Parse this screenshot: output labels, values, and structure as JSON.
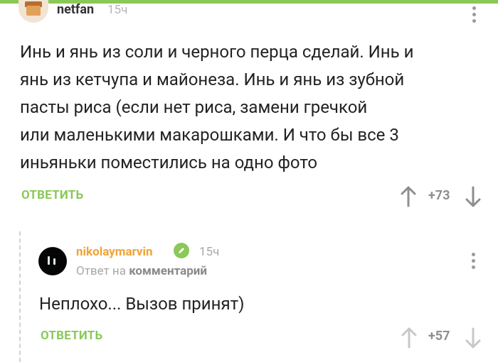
{
  "theme": {
    "accent": "#8ac858",
    "username_color": "#f0a43a"
  },
  "comment1": {
    "username": "netfan",
    "time": "15ч",
    "text_lines": [
      "Инь и янь из соли и черного перца сделай. Инь и",
      "янь из кетчупа и майонеза. Инь и янь из зубной",
      "пасты риса (если нет риса, замени гречкой",
      "или маленькими макарошками. И что бы все 3",
      "иньяньки поместились на одно фото"
    ],
    "reply_label": "ОТВЕТИТЬ",
    "rating": "+73"
  },
  "comment2": {
    "username": "nikolaymarvin",
    "time": "15ч",
    "reply_to_prefix": "Ответ на",
    "reply_to_target": "комментарий",
    "text": "Неплохо... Вызов принят)",
    "reply_label": "ОТВЕТИТЬ",
    "rating": "+57"
  },
  "icons": {
    "more": "more-vertical-icon",
    "up": "arrow-up-icon",
    "down": "arrow-down-icon",
    "edit": "pencil-icon"
  }
}
